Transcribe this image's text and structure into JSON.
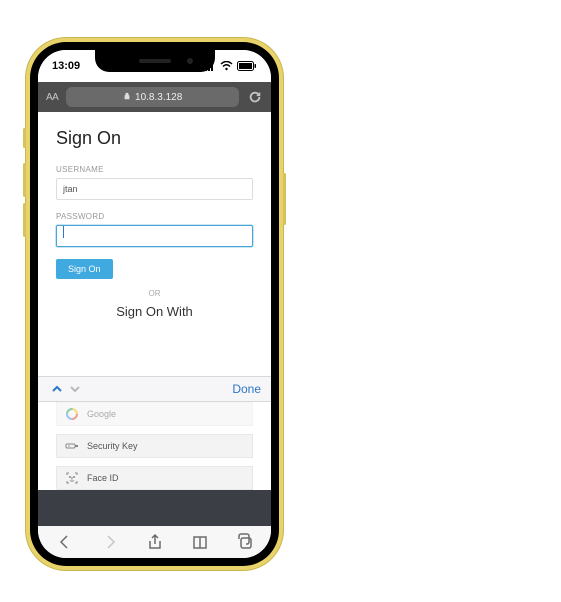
{
  "status": {
    "time": "13:09"
  },
  "url_bar": {
    "text_size_control": "AA",
    "address": "10.8.3.128"
  },
  "page": {
    "heading": "Sign On",
    "username_label": "USERNAME",
    "username_value": "jtan",
    "password_label": "PASSWORD",
    "password_value": "",
    "submit_label": "Sign On",
    "or_label": "OR",
    "alt_heading": "Sign On With"
  },
  "keyboard_bar": {
    "done_label": "Done"
  },
  "providers": [
    {
      "name": "Google"
    },
    {
      "name": "Security Key"
    },
    {
      "name": "Face ID"
    }
  ]
}
